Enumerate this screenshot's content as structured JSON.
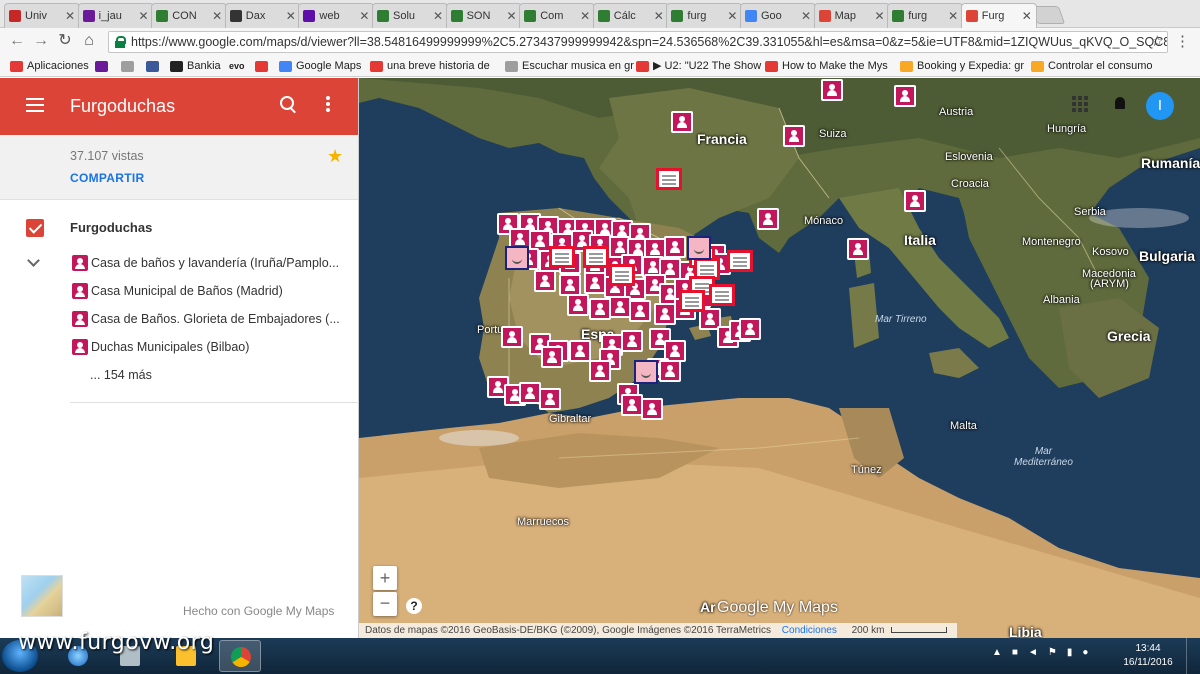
{
  "browser": {
    "tabs": [
      {
        "title": "Univ",
        "favicon": "up-icon",
        "color": "#c62828"
      },
      {
        "title": "i_jau",
        "favicon": "mail-icon",
        "color": "#6a1b9a"
      },
      {
        "title": "CON",
        "favicon": "forum-icon",
        "color": "#2e7d32"
      },
      {
        "title": "Dax",
        "favicon": "amazon-icon",
        "color": "#333333"
      },
      {
        "title": "web",
        "favicon": "yahoo-icon",
        "color": "#5e0fa8"
      },
      {
        "title": "Solu",
        "favicon": "forum-icon",
        "color": "#2e7d32"
      },
      {
        "title": "SON",
        "favicon": "forum-icon",
        "color": "#2e7d32"
      },
      {
        "title": "Com",
        "favicon": "forum-icon",
        "color": "#2e7d32"
      },
      {
        "title": "Cálc",
        "favicon": "forum-icon",
        "color": "#2e7d32"
      },
      {
        "title": "furg",
        "favicon": "forum-icon",
        "color": "#2e7d32"
      },
      {
        "title": "Goo",
        "favicon": "maps-icon",
        "color": "#4285f4"
      },
      {
        "title": "Map",
        "favicon": "mymaps-icon",
        "color": "#db4437"
      },
      {
        "title": "furg",
        "favicon": "forum-icon",
        "color": "#2e7d32"
      },
      {
        "title": "Furg",
        "favicon": "mymaps-icon",
        "color": "#db4437"
      }
    ],
    "url": "https://www.google.com/maps/d/viewer?ll=38.54816499999999%2C5.273437999999942&spn=24.536568%2C39.331055&hl=es&msa=0&z=5&ie=UTF8&mid=1ZIQWUus_qKVQ_O_SQC8",
    "bookmarks": [
      {
        "label": "Aplicaciones",
        "icon": "apps-icon",
        "color": "#e53935"
      },
      {
        "label": "",
        "icon": "mail-icon",
        "color": "#6a1b9a"
      },
      {
        "label": "",
        "icon": "doc-icon",
        "color": "#9e9e9e"
      },
      {
        "label": "",
        "icon": "facebook-icon",
        "color": "#3b5998"
      },
      {
        "label": "Bankia",
        "icon": "bankia-icon",
        "color": "#222222"
      },
      {
        "label": "evo",
        "icon": "",
        "color": ""
      },
      {
        "label": "",
        "icon": "youtube-icon",
        "color": "#e53935"
      },
      {
        "label": "Google Maps",
        "icon": "maps-icon",
        "color": "#4285f4"
      },
      {
        "label": "una breve historia de",
        "icon": "youtube-icon",
        "color": "#e53935"
      },
      {
        "label": "Escuchar musica en gr",
        "icon": "doc-icon",
        "color": "#9e9e9e"
      },
      {
        "label": "▶ U2: \"U22 The Show",
        "icon": "youtube-icon",
        "color": "#e53935"
      },
      {
        "label": "How to Make the Mys",
        "icon": "youtube-icon",
        "color": "#e53935"
      },
      {
        "label": "Booking y Expedia: gr",
        "icon": "bulb-icon",
        "color": "#f9a825"
      },
      {
        "label": "Controlar el consumo",
        "icon": "bulb-icon",
        "color": "#f9a825"
      }
    ]
  },
  "panel": {
    "title": "Furgoduchas",
    "views": "37.107 vistas",
    "share": "COMPARTIR",
    "layer": "Furgoduchas",
    "places": [
      "Casa de baños y lavandería (Iruña/Pamplo...",
      "Casa Municipal de Baños (Madrid)",
      "Casa de Baños. Glorieta de Embajadores (...",
      "Duchas Municipales (Bilbao)"
    ],
    "more": "... 154 más",
    "made_with": "Hecho con Google My Maps"
  },
  "map": {
    "labels": {
      "francia": "Francia",
      "austria": "Austria",
      "hungria": "Hungría",
      "suiza": "Suiza",
      "eslovenia": "Eslovenia",
      "croacia": "Croacia",
      "rumania": "Rumanía",
      "serbia": "Serbia",
      "italia": "Italia",
      "monaco": "Mónaco",
      "montenegro": "Montenegro",
      "kosovo": "Kosovo",
      "bulgaria": "Bulgaria",
      "macedonia": "Macedonia",
      "arym": "(ARYM)",
      "albania": "Albania",
      "grecia": "Grecia",
      "portugal": "Portu",
      "espana": "Espa",
      "gibraltar": "Gibraltar",
      "mar_tirreno": "Mar Tirreno",
      "malta": "Malta",
      "tunez": "Túnez",
      "mar_mediterraneo": "Mar\nMediterráneo",
      "marruecos": "Marruecos",
      "argelia": "Ar",
      "libia": "Libia"
    },
    "logo": "Google My Maps",
    "attribution": "Datos de mapas ©2016 GeoBasis-DE/BKG (©2009), Google Imágenes ©2016 TerraMetrics",
    "terms": "Condiciones",
    "scale": "200 km",
    "zoom_in": "+",
    "zoom_out": "−",
    "help": "?",
    "avatar": "I"
  },
  "taskbar": {
    "watermark": "www.furgovw.org",
    "time": "13:44",
    "date": "16/11/2016"
  }
}
